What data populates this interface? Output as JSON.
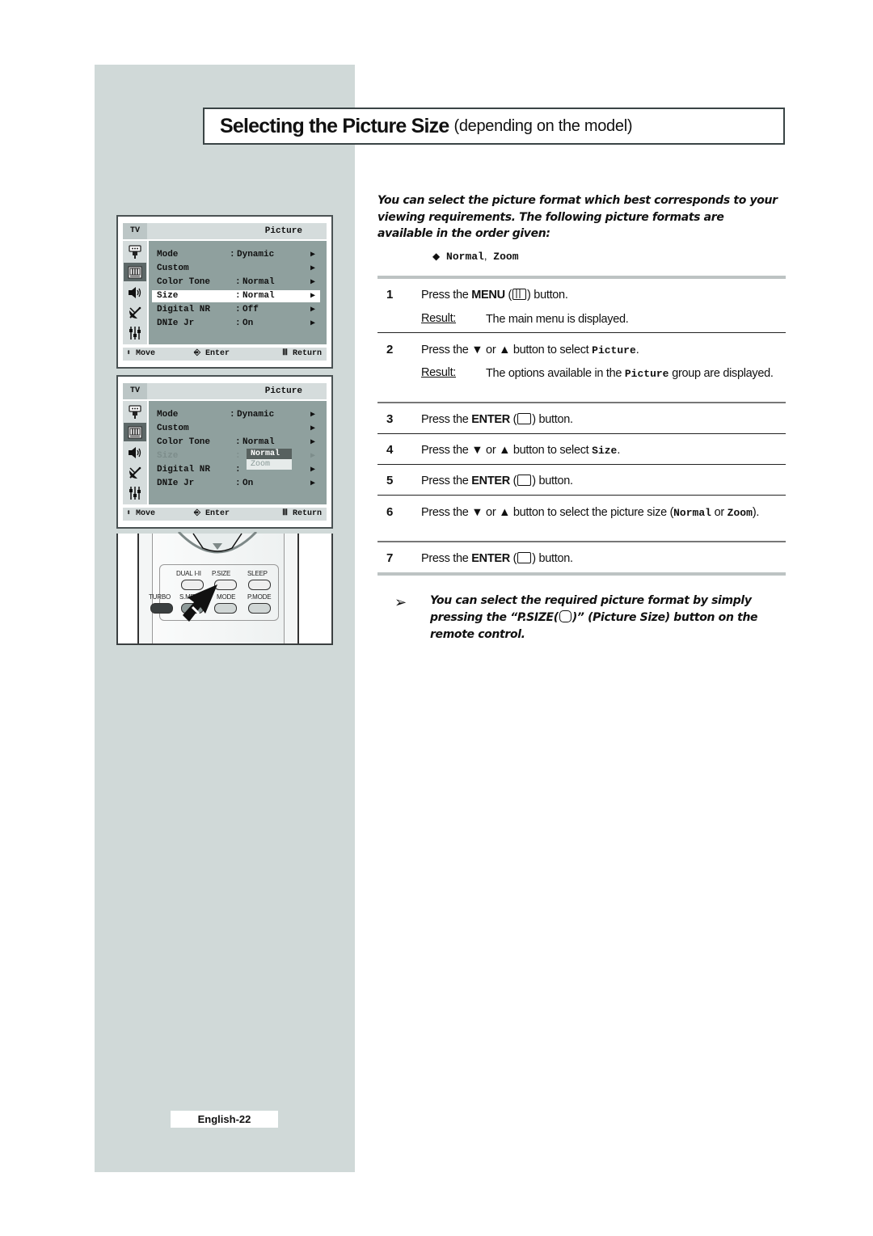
{
  "page": {
    "title_bold": "Selecting the Picture Size",
    "title_light": "(depending on the model)",
    "page_number": "English-22"
  },
  "osd_menus": [
    {
      "tv_label": "TV",
      "title": "Picture",
      "rows": [
        {
          "label": "Mode",
          "colon": ":",
          "value": "Dynamic",
          "state": "normal"
        },
        {
          "label": "Custom",
          "colon": "",
          "value": "",
          "state": "normal"
        },
        {
          "label": "Color Tone",
          "colon": ":",
          "value": "Normal",
          "state": "normal"
        },
        {
          "label": "Size",
          "colon": ":",
          "value": "Normal",
          "state": "selected"
        },
        {
          "label": "Digital NR",
          "colon": ":",
          "value": "Off",
          "state": "normal"
        },
        {
          "label": "DNIe Jr",
          "colon": ":",
          "value": "On",
          "state": "normal"
        }
      ],
      "footer": {
        "move": "Move",
        "enter": "Enter",
        "return": "Return"
      }
    },
    {
      "tv_label": "TV",
      "title": "Picture",
      "rows": [
        {
          "label": "Mode",
          "colon": ":",
          "value": "Dynamic",
          "state": "normal"
        },
        {
          "label": "Custom",
          "colon": "",
          "value": "",
          "state": "normal"
        },
        {
          "label": "Color Tone",
          "colon": ":",
          "value": "Normal",
          "state": "normal"
        },
        {
          "label": "Size",
          "colon": ":",
          "value": "",
          "state": "dimmed"
        },
        {
          "label": "Digital NR",
          "colon": ":",
          "value": "",
          "state": "normal"
        },
        {
          "label": "DNIe Jr",
          "colon": ":",
          "value": "On",
          "state": "normal"
        }
      ],
      "dropdown": {
        "options": [
          "Normal",
          "Zoom"
        ],
        "selected": "Normal"
      },
      "footer": {
        "move": "Move",
        "enter": "Enter",
        "return": "Return"
      }
    }
  ],
  "osd_icons": [
    "input-icon",
    "picture-icon",
    "sound-icon",
    "channel-icon",
    "setup-icon"
  ],
  "remote": {
    "top_labels": [
      "DUAL I-II",
      "P.SIZE",
      "SLEEP"
    ],
    "bottom_labels": [
      "TURBO",
      "S.MENU",
      "MODE",
      "P.MODE"
    ]
  },
  "intro": "You can select the picture format which best corresponds to your viewing requirements. The following picture formats are available in the order given:",
  "formats": {
    "first": "Normal",
    "separator": ",",
    "second": "Zoom"
  },
  "steps": [
    {
      "num": "1",
      "pre": "Press the ",
      "bold": "MENU",
      "post": " button.",
      "result_label": "Result:",
      "result": "The main menu is displayed."
    },
    {
      "num": "2",
      "pre": "Press the ▼ or ▲ button to select ",
      "mono": "Picture",
      "post": ".",
      "result_label": "Result:",
      "result_pre": "The options available in the ",
      "result_mono": "Picture",
      "result_post": " group are displayed."
    },
    {
      "num": "3",
      "pre": "Press the ",
      "bold": "ENTER",
      "post": " button."
    },
    {
      "num": "4",
      "pre": "Press the ▼ or ▲ button to select ",
      "mono": "Size",
      "post": "."
    },
    {
      "num": "5",
      "pre": "Press the ",
      "bold": "ENTER",
      "post": " button."
    },
    {
      "num": "6",
      "pre": "Press the ▼ or ▲ button to select the picture size (",
      "mono": "Normal",
      "mid": " or ",
      "mono2": "Zoom",
      "post": ")."
    },
    {
      "num": "7",
      "pre": "Press the ",
      "bold": "ENTER",
      "post": " button."
    }
  ],
  "note": {
    "pre": "You can select the required picture format by simply pressing the “P.SIZE(",
    "post": ")” (Picture Size) button on the remote control."
  }
}
